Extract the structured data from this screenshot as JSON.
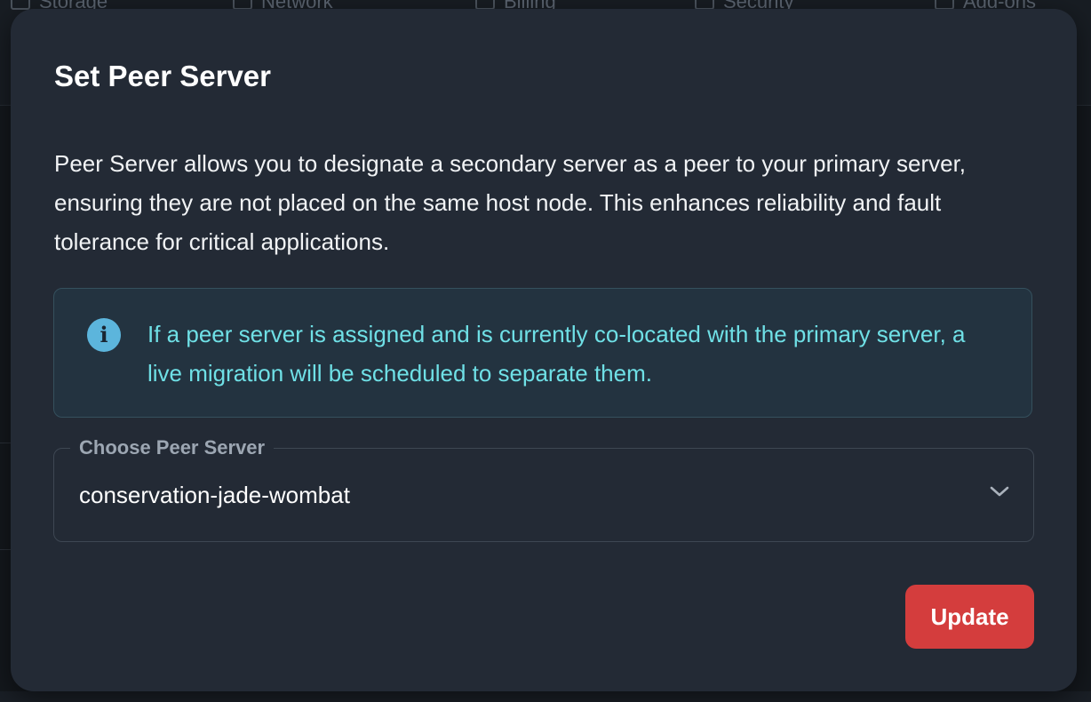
{
  "background": {
    "tabs": [
      {
        "label": "Storage",
        "icon": "storage-icon"
      },
      {
        "label": "Network",
        "icon": "network-icon"
      },
      {
        "label": "Billing",
        "icon": "billing-icon"
      },
      {
        "label": "Security",
        "icon": "security-icon"
      },
      {
        "label": "Add-ons",
        "icon": "addons-icon"
      }
    ]
  },
  "modal": {
    "title": "Set Peer Server",
    "description": "Peer Server allows you to designate a secondary server as a peer to your primary server, ensuring they are not placed on the same host node. This enhances reliability and fault tolerance for critical applications.",
    "info": {
      "icon": "info-icon",
      "text": "If a peer server is assigned and is currently co-located with the primary server, a live migration will be scheduled to separate them."
    },
    "select": {
      "label": "Choose Peer Server",
      "value": "conservation-jade-wombat",
      "icon": "chevron-down-icon"
    },
    "update_label": "Update"
  },
  "colors": {
    "modal_bg": "#232a35",
    "info_text": "#6fe0e6",
    "info_icon": "#5cb5dc",
    "primary_button": "#d43d3d"
  }
}
